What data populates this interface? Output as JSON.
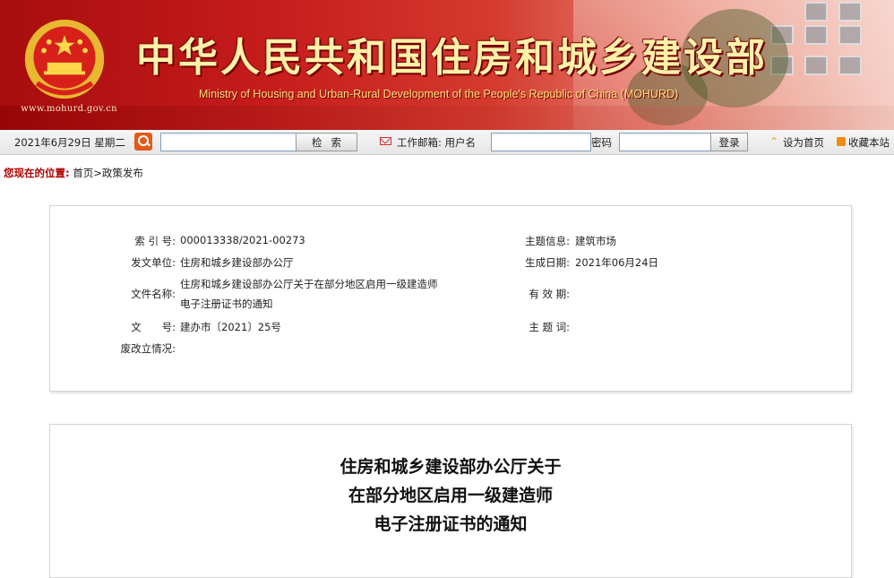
{
  "header": {
    "title_cn": "中华人民共和国住房和城乡建设部",
    "title_en": "Ministry of Housing and Urban-Rural Development of the People's Republic of China (MOHURD)",
    "site_url": "www.mohurd.gov.cn"
  },
  "toolbar": {
    "date": "2021年6月29日 星期二",
    "search_placeholder": "",
    "search_button": "检索",
    "mail_label": "工作邮箱: 用户名",
    "password_label": "密码",
    "login_button": "登录",
    "home_icon": "upward-arrow-icon",
    "set_home": "设为首页",
    "bookmark": "收藏本站"
  },
  "breadcrumb": {
    "label": "您现在的位置:",
    "path": "首页>政策发布"
  },
  "info": {
    "index_label": "索 引 号:",
    "index_value": "000013338/2021-00273",
    "topic_label": "主题信息:",
    "topic_value": "建筑市场",
    "issuer_label": "发文单位:",
    "issuer_value": "住房和城乡建设部办公厅",
    "date_label": "生成日期:",
    "date_value": "2021年06月24日",
    "filename_label": "文件名称:",
    "filename_line1": "住房和城乡建设部办公厅关于在部分地区启用一级建造师",
    "filename_line2": "电子注册证书的通知",
    "validity_label": "有 效 期:",
    "docno_label": "文　　号:",
    "docno_value": "建办市〔2021〕25号",
    "keyword_label": "主 题 词:",
    "status_label": "废改立情况:"
  },
  "document": {
    "title_line1": "住房和城乡建设部办公厅关于",
    "title_line2": "在部分地区启用一级建造师",
    "title_line3": "电子注册证书的通知"
  },
  "colors": {
    "banner_red": "#c61c1c",
    "title_gold": "#fff1a8",
    "breadcrumb_red": "#b00000",
    "search_orange": "#e35a1a"
  }
}
